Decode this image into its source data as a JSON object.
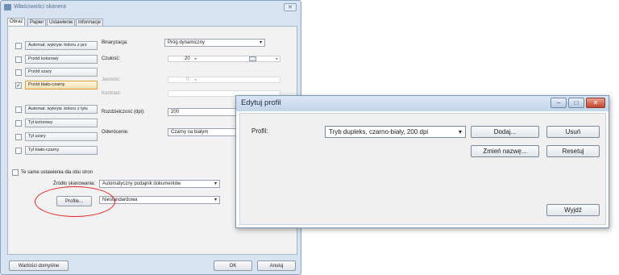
{
  "scanner_window": {
    "title": "Właściwości skanera",
    "tabs": [
      "Obraz",
      "Papier",
      "Ustawienie",
      "Informacje"
    ],
    "image_types_front": [
      {
        "label": "Automat. wykryw. koloru z prz",
        "checked": false,
        "selected": false
      },
      {
        "label": "Przód kolorowy",
        "checked": false,
        "selected": false
      },
      {
        "label": "Przód szary",
        "checked": false,
        "selected": false
      },
      {
        "label": "Przód biało-czarny",
        "checked": true,
        "selected": true
      }
    ],
    "image_types_back": [
      {
        "label": "Automat. wykryw. koloru z tyłu",
        "checked": false
      },
      {
        "label": "Tył kolorowy",
        "checked": false
      },
      {
        "label": "Tył szary",
        "checked": false
      },
      {
        "label": "Tył biało-czarny",
        "checked": false
      }
    ],
    "binarization_label": "Binaryzacja:",
    "binarization_value": "Próg dynamiczny",
    "sensitivity_label": "Czułość:",
    "sensitivity_value": "20",
    "brightness_label": "Jasność:",
    "brightness_value": "0",
    "contrast_label": "Kontrast:",
    "resolution_label": "Rozdzielczość (dpi):",
    "resolution_value": "200",
    "inversion_label": "Odwrócenie:",
    "inversion_value": "Czarny na białym",
    "same_settings_label": "Te same ustawienia dla obu stron",
    "scan_source_label": "Źródło skanowania:",
    "scan_source_value": "Automatyczny podajnik dokumentów",
    "profile_button": "Profile...",
    "profile_value": "Niestandardowa",
    "defaults_button": "Wartości domyślne",
    "ok_button": "OK",
    "cancel_button": "Anuluj"
  },
  "edit_profile_dialog": {
    "title": "Edytuj profil",
    "profile_label": "Profil:",
    "profile_value": "Tryb dupleks, czarno-biały, 200 dpi",
    "add_button": "Dodaj...",
    "delete_button": "Usuń",
    "rename_button": "Zmień nazwę...",
    "reset_button": "Resetuj",
    "exit_button": "Wyjdź"
  },
  "colors": {
    "highlight_circle": "#e02020",
    "selected_item": "#f6dfae"
  }
}
